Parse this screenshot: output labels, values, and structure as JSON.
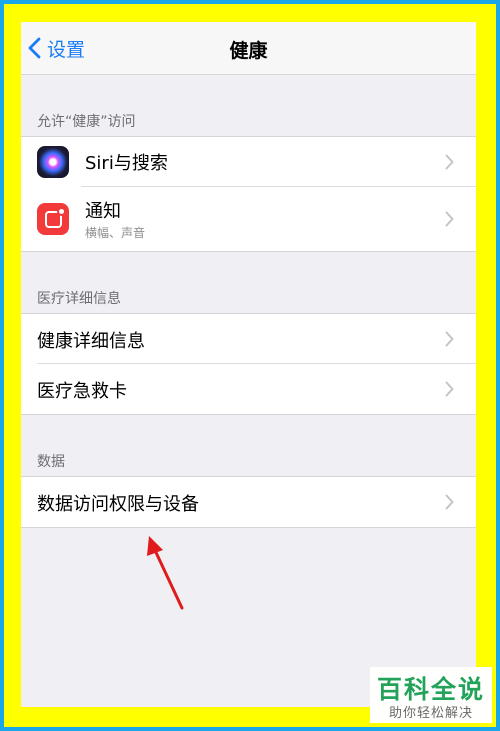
{
  "navbar": {
    "back_label": "设置",
    "title": "健康"
  },
  "sections": [
    {
      "header": "允许“健康”访问",
      "rows": [
        {
          "label": "Siri与搜索",
          "icon": "siri-icon"
        },
        {
          "label": "通知",
          "subtitle": "横幅、声音",
          "icon": "notification-icon"
        }
      ]
    },
    {
      "header": "医疗详细信息",
      "rows": [
        {
          "label": "健康详细信息"
        },
        {
          "label": "医疗急救卡"
        }
      ]
    },
    {
      "header": "数据",
      "rows": [
        {
          "label": "数据访问权限与设备"
        }
      ]
    }
  ],
  "watermark": {
    "main": "百科全说",
    "sub": "助你轻松解决"
  },
  "colors": {
    "outer_border": "#1aa6e8",
    "inner_border": "#ffff00",
    "ios_blue": "#1a7cf3",
    "annotation_arrow": "#e01b1b",
    "watermark_green": "#23a35a"
  }
}
